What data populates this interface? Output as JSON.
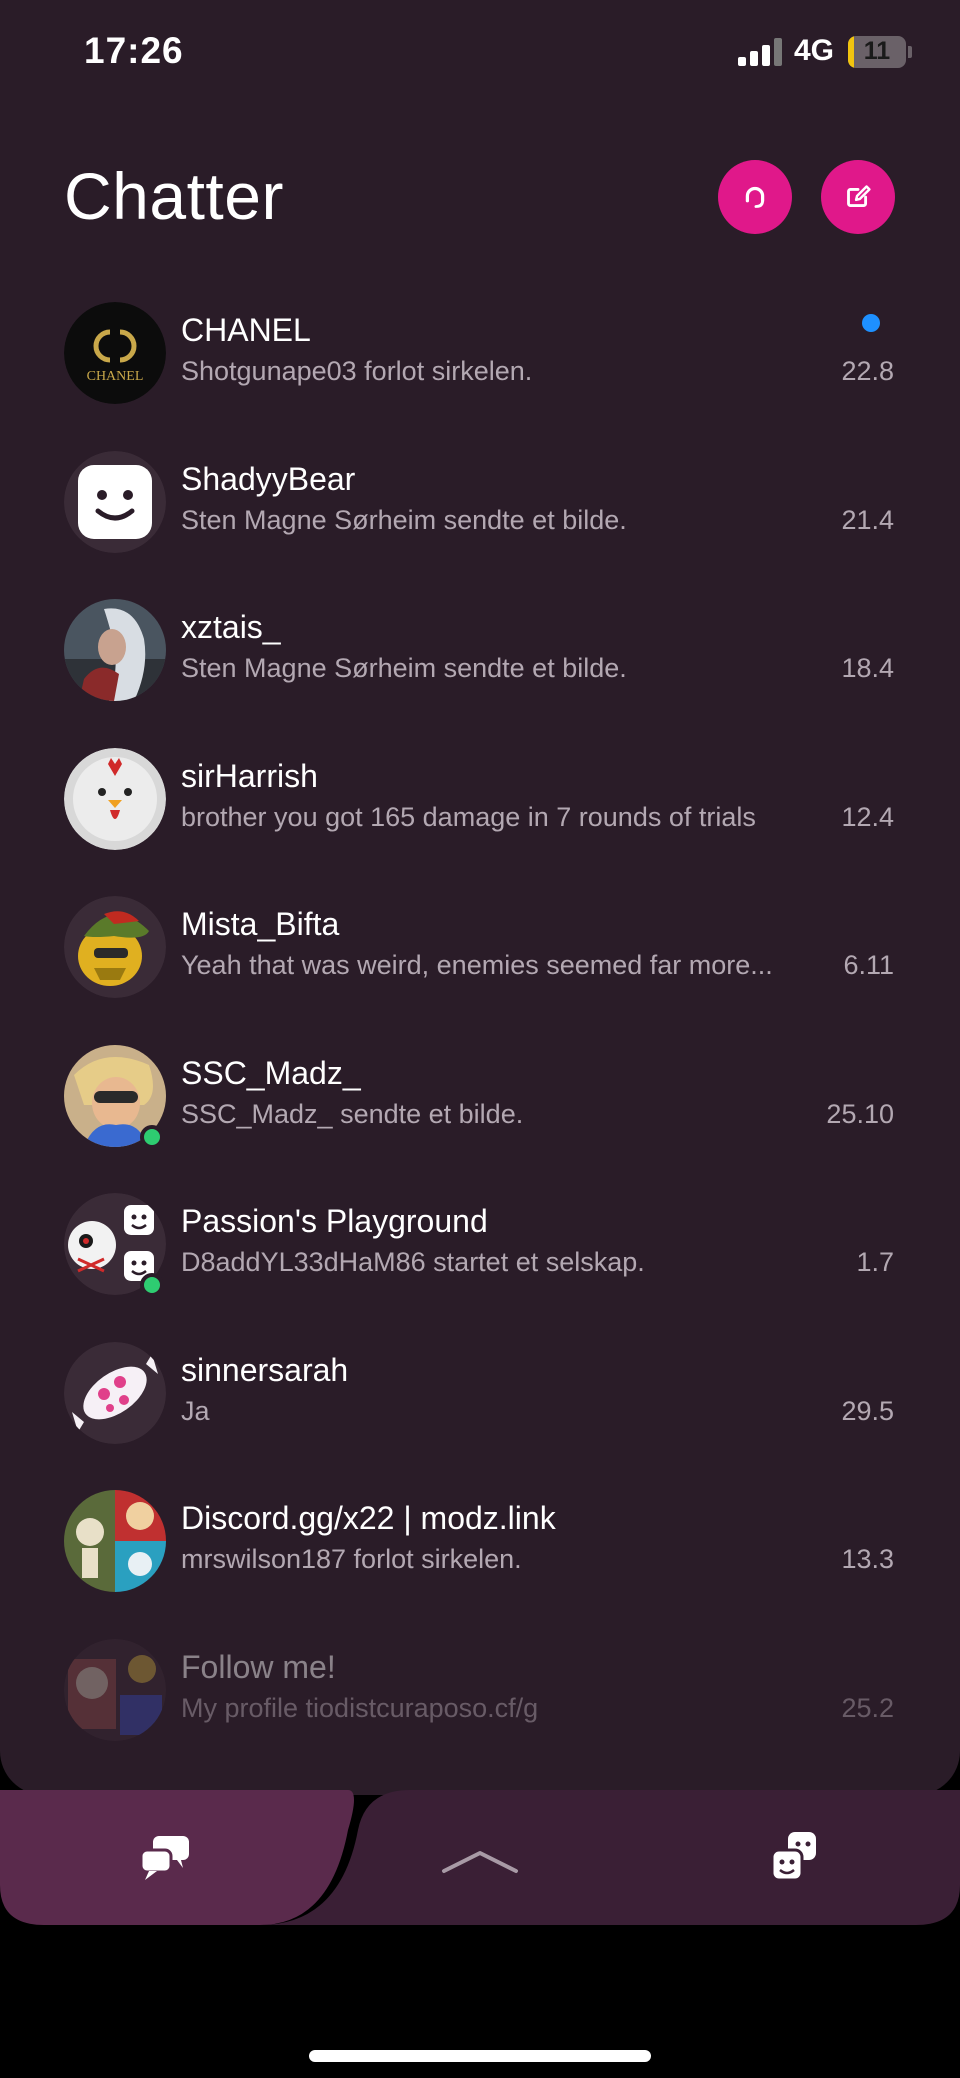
{
  "status_bar": {
    "time": "17:26",
    "network": "4G",
    "battery": "11",
    "battery_level": 0.11
  },
  "header": {
    "title": "Chatter",
    "support_icon": "headset-icon",
    "compose_icon": "compose-icon"
  },
  "colors": {
    "background": "#2a1c28",
    "accent": "#e0188a",
    "unread": "#1e90ff",
    "online": "#2ecc71",
    "nav": "#5a2a4c"
  },
  "chats": [
    {
      "name": "CHANEL",
      "preview": "Shotgunape03 forlot sirkelen.",
      "date": "22.8",
      "unread": true,
      "online": false,
      "avatar": "chanel-logo"
    },
    {
      "name": "ShadyyBear",
      "preview": "Sten Magne Sørheim sendte et bilde.",
      "date": "21.4",
      "unread": false,
      "online": false,
      "avatar": "default-face"
    },
    {
      "name": "xztais_",
      "preview": "Sten Magne Sørheim sendte et bilde.",
      "date": "18.4",
      "unread": false,
      "online": false,
      "avatar": "character"
    },
    {
      "name": "sirHarrish",
      "preview": "brother you got 165 damage in 7 rounds of trials",
      "date": "12.4",
      "unread": false,
      "online": false,
      "avatar": "chicken"
    },
    {
      "name": "Mista_Bifta",
      "preview": "Yeah that was weird, enemies seemed far more...",
      "date": "6.11",
      "unread": false,
      "online": false,
      "avatar": "gold-helmet"
    },
    {
      "name": "SSC_Madz_",
      "preview": "SSC_Madz_ sendte et bilde.",
      "date": "25.10",
      "unread": false,
      "online": true,
      "avatar": "cartoon-woman"
    },
    {
      "name": "Passion's Playground",
      "preview": "D8addYL33dHaM86 startet et selskap.",
      "date": "1.7",
      "unread": false,
      "online": true,
      "avatar": "group"
    },
    {
      "name": "sinnersarah",
      "preview": "Ja",
      "date": "29.5",
      "unread": false,
      "online": false,
      "avatar": "candy"
    },
    {
      "name": "Discord.gg/x22 | modz.link",
      "preview": "mrswilson187 forlot sirkelen.",
      "date": "13.3",
      "unread": false,
      "online": false,
      "avatar": "group-collage"
    },
    {
      "name": "Follow me!",
      "preview": "My profile tiodistcuraposo.cf/g",
      "date": "25.2",
      "unread": false,
      "online": false,
      "avatar": "group-collage-2"
    }
  ],
  "bottom_nav": {
    "chat_icon": "chat-bubbles-icon",
    "expand_icon": "chevron-up-icon",
    "party_icon": "party-icon"
  }
}
